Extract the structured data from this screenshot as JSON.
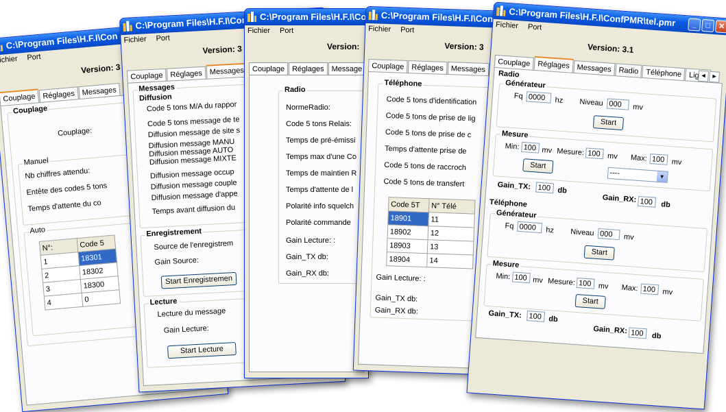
{
  "windows": {
    "w1": {
      "title": "C:\\Program Files\\H.F.I\\Con",
      "menu": [
        "Fichier",
        "Port"
      ],
      "version": "Version: 3",
      "tabs": [
        "Couplage",
        "Réglages",
        "Messages"
      ],
      "group_title": "Couplage",
      "couplage_label": "Couplage:",
      "manuel_title": "Manuel",
      "manuel_rows": [
        "Nb chiffres attendu:",
        "Entête des codes 5 tons",
        "Temps d'attente du co"
      ],
      "auto_title": "Auto",
      "table_headers": [
        "N°:",
        "Code 5"
      ],
      "table_rows": [
        [
          "1",
          "18301"
        ],
        [
          "2",
          "18302"
        ],
        [
          "3",
          "18300"
        ],
        [
          "4",
          "0"
        ]
      ]
    },
    "w2": {
      "title": "C:\\Program Files\\H.F.I\\Con",
      "menu": [
        "Fichier",
        "Port"
      ],
      "version": "Version: 3",
      "tabs": [
        "Couplage",
        "Réglages",
        "Messages"
      ],
      "messages_title": "Messages",
      "diffusion_title": "Diffusion",
      "diffusion_rows": [
        "Code 5 tons M/A du rappor",
        "Code 5 tons message de te",
        "Diffusion message de site s",
        "Diffusion message MANU",
        "Diffusion message AUTO",
        "Diffusion message MIXTE",
        "Diffusion message occup",
        "Diffusion message couple",
        "Diffusion message d'appe",
        "Temps avant diffusion du"
      ],
      "enregistrement_title": "Enregistrement",
      "source_label": "Source de l'enregistrem",
      "gain_source_label": "Gain Source:",
      "start_enr_button": "Start Enregistremen",
      "lecture_title": "Lecture",
      "lecture_label": "Lecture du message",
      "gain_lecture_label": "Gain Lecture:",
      "start_lecture_button": "Start Lecture"
    },
    "w3": {
      "title": "C:\\Program Files\\H.F.I\\Co",
      "menu": [
        "Fichier",
        "Port"
      ],
      "version": "Version:",
      "tabs": [
        "Couplage",
        "Réglages",
        "Message"
      ],
      "group_title": "Radio",
      "rows": [
        "NormeRadio:",
        "Code 5 tons Relais:",
        "Temps de pré-émissi",
        "Temps max d'une Co",
        "Temps de maintien R",
        "Temps d'attente de l",
        "Polarité info squelch",
        "Polarité commande"
      ],
      "gain_lecture": "Gain Lecture: :",
      "gain_tx": "Gain_TX db:",
      "gain_rx": "Gain_RX db:"
    },
    "w4": {
      "title": "C:\\Program Files\\H.F.I\\Con",
      "menu": [
        "Fichier",
        "Port"
      ],
      "version": "Version: 3",
      "tabs": [
        "Couplage",
        "Réglages",
        "Messages"
      ],
      "group_title": "Téléphone",
      "rows": [
        "Code 5 tons d'identification",
        "Code 5 tons de prise de lig",
        "Code 5 tons de prise de c",
        "Temps d'attente prise de",
        "Code 5 tons de raccroch",
        "Code 5 tons de transfert"
      ],
      "table_headers": [
        "Code 5T",
        "N° Télé"
      ],
      "table_rows": [
        [
          "18901",
          "11"
        ],
        [
          "18902",
          "12"
        ],
        [
          "18903",
          "13"
        ],
        [
          "18904",
          "14"
        ]
      ],
      "gain_lecture": "Gain Lecture: :",
      "gain_tx": "Gain_TX db:",
      "gain_rx": "Gain_RX db:"
    },
    "w5": {
      "title": "C:\\Program Files\\H.F.I\\ConfPMR\\tel.pmr",
      "menu": [
        "Fichier",
        "Port"
      ],
      "version": "Version: 3.1",
      "tabs": [
        "Couplage",
        "Réglages",
        "Messages",
        "Radio",
        "Téléphone",
        "Ligne"
      ],
      "radio_title": "Radio",
      "generateur_title": "Générateur",
      "fq_label": "Fq",
      "fq_value": "0000",
      "hz": "hz",
      "niveau_label": "Niveau",
      "niveau_value": "000",
      "mv": "mv",
      "start": "Start",
      "mesure_title": "Mesure",
      "min_label": "Min:",
      "min_value": "100",
      "mesure_label": "Mesure:",
      "mesure_value": "100",
      "max_label": "Max:",
      "max_value": "100",
      "combo_value": "----",
      "gain_tx_label": "Gain_TX:",
      "gain_tx_value": "100",
      "gain_rx_label": "Gain_RX:",
      "gain_rx_value": "100",
      "db": "db",
      "telephone_title": "Téléphone"
    }
  },
  "colors": {
    "titlebar": "#0a5be0",
    "face": "#ece9d8",
    "selection": "#316ac5",
    "tab_highlight": "#e68b2c",
    "close": "#c2401f"
  }
}
